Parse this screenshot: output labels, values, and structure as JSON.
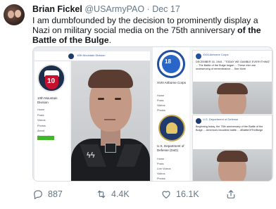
{
  "tweet": {
    "author_name": "Brian Fickel",
    "handle": "@USArmyPAO",
    "separator": "·",
    "date": "Dec 17",
    "text_plain": "I am dumbfounded by the decision to prominently display a Nazi on military social media on the 75th anniversary ",
    "text_bold": "of the Battle of the Bulge",
    "text_end": "."
  },
  "screenshot_left": {
    "page_name": "10th Mountain Division",
    "nav": [
      "Home",
      "Posts",
      "Videos",
      "Photos",
      "About",
      "Community"
    ],
    "topbar_title": "10th Mountain Division"
  },
  "screenshot_right": {
    "page_name": "XVIII Airborne Corps",
    "nav": [
      "Home",
      "Posts",
      "Videos",
      "Photos",
      "About"
    ],
    "logo_number": "18",
    "second_page_name": "U.S. Department of Defense (DoD)",
    "second_nav": [
      "Home",
      "Posts",
      "Live Videos",
      "Videos",
      "Photos"
    ],
    "post1_header": "XVIII Airborne Corps",
    "post1_text": "DECEMBER 16, 1944 - \"TODAY WE GAMBLE EVERYTHING\" ... The Battle of the Bulge began ... These men are undeserving of remembrance ... See More",
    "post2_header": "U.S. Department of Defense",
    "post2_text": "Beginning today, the 75th anniversary of the Battle of the Bulge ... America's bloodiest battle ... #BattleOfTheBulge"
  },
  "logo_left": {
    "number": "10"
  },
  "actions": {
    "replies": "887",
    "retweets": "4.4K",
    "likes": "16.1K"
  },
  "colors": {
    "text_primary": "#14171a",
    "text_secondary": "#657786",
    "facebook_blue": "#385898"
  }
}
